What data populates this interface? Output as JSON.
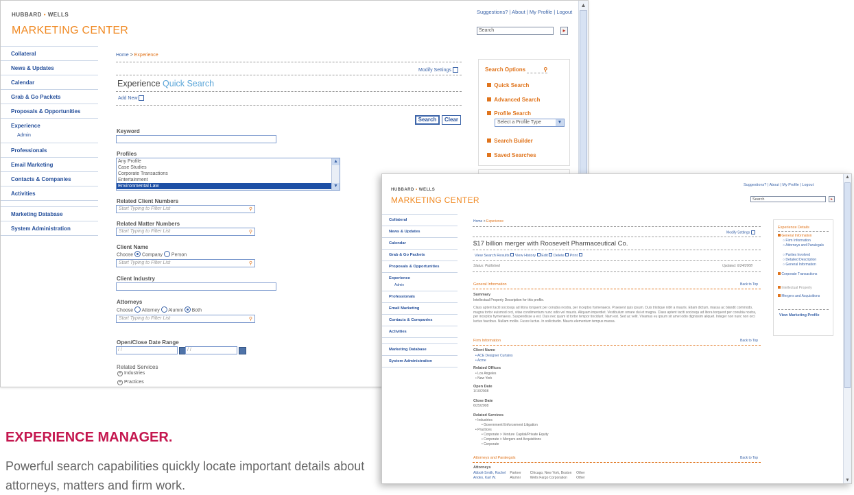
{
  "screen1": {
    "brand_small": "HUBBARD",
    "brand_small_dot": "•",
    "brand_small_2": "WELLS",
    "brand_big": "MARKETING CENTER",
    "top_links": "Suggestions? | About | My Profile | Logout",
    "search_value": "Search",
    "go_glyph": "▸",
    "nav": {
      "collateral": "Collateral",
      "news": "News & Updates",
      "calendar": "Calendar",
      "grab": "Grab & Go Packets",
      "proposals": "Proposals & Opportunities",
      "experience": "Experience",
      "admin": "Admin",
      "professionals": "Professionals",
      "email": "Email Marketing",
      "contacts": "Contacts & Companies",
      "activities": "Activities",
      "marketing_db": "Marketing Database",
      "sysadmin": "System Administration"
    },
    "breadcrumb_home": "Home",
    "breadcrumb_sep": " > ",
    "breadcrumb_current": "Experience",
    "modify_settings": "Modify Settings",
    "title_main": "Experience",
    "title_accent": "Quick Search",
    "add_new": "Add New",
    "search_button": "Search",
    "clear_button": "Clear",
    "keyword_label": "Keyword",
    "profiles_label": "Profiles",
    "profiles_options": [
      "Any Profile",
      "Case Studies",
      "Corporate Transactions",
      "Entertainment",
      "Environmental Law"
    ],
    "related_client_label": "Related Client Numbers",
    "filter_placeholder": "Start Typing to Filter List",
    "related_matter_label": "Related Matter Numbers",
    "client_name_label": "Client Name",
    "choose": "Choose",
    "company": "Company",
    "person": "Person",
    "client_industry_label": "Client Industry",
    "attorneys_label": "Attorneys",
    "attorney": "Attorney",
    "alumni": "Alumni",
    "both": "Both",
    "date_range_label": "Open/Close Date Range",
    "date_placeholder": " / /",
    "date_to": "to",
    "related_services_label": "Related Services",
    "industries": "Industries",
    "practices": "Practices",
    "search_options_title": "Search Options",
    "options": {
      "quick": "Quick Search",
      "advanced": "Advanced Search",
      "profile": "Profile Search",
      "profile_select": "Select a Profile Type",
      "builder": "Search Builder",
      "saved": "Saved Searches"
    }
  },
  "screen2": {
    "brand_small": "HUBBARD",
    "brand_small_dot": "•",
    "brand_small_2": "WELLS",
    "brand_big": "MARKETING CENTER",
    "top_links": "Suggestions? | About | My Profile | Logout",
    "search_value": "Search",
    "go_glyph": "▸",
    "nav": {
      "collateral": "Collateral",
      "news": "News & Updates",
      "calendar": "Calendar",
      "grab": "Grab & Go Packets",
      "proposals": "Proposals & Opportunities",
      "experience": "Experience",
      "admin": "Admin",
      "professionals": "Professionals",
      "email": "Email Marketing",
      "contacts": "Contacts & Companies",
      "activities": "Activities",
      "marketing_db": "Marketing Database",
      "sysadmin": "System Administration"
    },
    "breadcrumb_home": "Home",
    "breadcrumb_sep": " > ",
    "breadcrumb_current": "Experience",
    "modify_settings": "Modify Settings",
    "title": "$17 billion merger with Roosevelt Pharmaceutical Co.",
    "actions": {
      "view_results": "View Search Results",
      "view_history": "View History",
      "edit": "Edit",
      "delete": "Delete",
      "print": "Print"
    },
    "status": "Status: Published",
    "updated": "Updated: 6/24/2008",
    "general_info_heading": "General Information",
    "back_to_top": "Back to Top",
    "summary_label": "Summary",
    "summary_text": "Intellectual Property Description for this profile.",
    "lorem_text": "Class aptent taciti sociosqu ad litora torquent per conubia nostra, per inceptos hymenaeos. Praesent quis ipsum. Duis tristique nibh a mauris. Etiam dictum, massa ac blandit commodo, magna tortor euismod orci, vitae condimentum nunc odio vel mauris. Aliquam imperdiet. Vestibulum ornare dui et magna. Class aptent taciti sociosqu ad litora torquent per conubia nostra, per inceptos hymenaeos. Suspendisse a est. Duis nec quam id tortor tempor tincidunt. Nam est. Sed ac velit. Vivamus eu ipsum sit amet odio dignissim aliquet. Integer non nunc non orci luctus faucibus. Nullam mollis. Fusce luctus. In sollicitudin. Mauris elementum tempus massa.",
    "firm_info_heading": "Firm Information",
    "client_name_label": "Client Name",
    "clients": [
      "ACE Designer Curtains",
      "Acme"
    ],
    "related_offices_label": "Related Offices",
    "offices": [
      "Los Angeles",
      "New York"
    ],
    "open_date_label": "Open Date",
    "open_date": "1/10/2008",
    "close_date_label": "Close Date",
    "close_date": "6/25/2008",
    "related_services_label": "Related Services",
    "industries": "Industries",
    "industry_items": [
      "Government Enforcement Litigation"
    ],
    "practices": "Practices",
    "practice_items": [
      "Corporate > Venture Capital/Private Equity",
      "Corporate > Mergers and Acquisitions",
      "Corporate"
    ],
    "attorneys_heading": "Attorneys and Paralegals",
    "attorneys_label": "Attorneys",
    "attorney_rows": [
      [
        "Abbott-Smith, Rachel",
        "Partner",
        "Chicago, New York, Boston",
        "Other"
      ],
      [
        "Andes, Karl W.",
        "Alumni",
        "Wells Fargo Corporation",
        "Other"
      ]
    ],
    "details_title": "Experience Details",
    "details": {
      "general": "General Information",
      "firm": "Firm Information",
      "attorneys_paralegals": "Attorneys and Paralegals",
      "parties": "Parties Involved",
      "detailed": "Detailed Description",
      "general2": "General Information",
      "corporate": "Corporate Transactions",
      "ip": "Intellectual Property",
      "mergers": "Mergers and Acquisitions"
    },
    "view_profile": "View Marketing Profile"
  },
  "caption": {
    "title": "EXPERIENCE MANAGER.",
    "body": "Powerful search capabilities quickly locate important details about attorneys, matters and firm work."
  },
  "colors": {
    "accent_orange": "#e0741c",
    "brand_orange": "#f08a24",
    "nav_blue": "#26509b",
    "caption_red": "#c4174f"
  },
  "icons": {
    "search": "magnifier-icon",
    "doc": "document-icon",
    "calendar": "calendar-icon",
    "go": "arrow-right-icon",
    "dropdown": "chevron-down-icon",
    "expand": "plus-circle-icon",
    "bullet": "orange-square-bullet-icon"
  }
}
